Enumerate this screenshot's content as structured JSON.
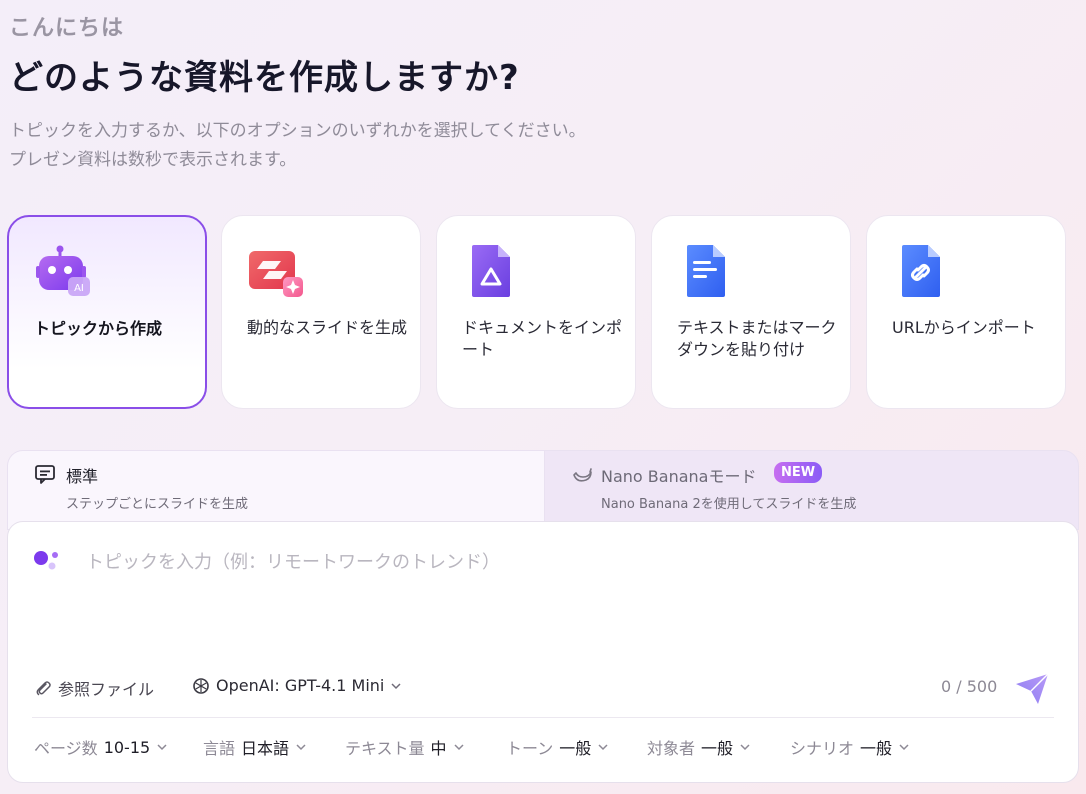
{
  "header": {
    "greeting": "こんにちは",
    "title": "どのような資料を作成しますか?",
    "subtitle_line1": "トピックを入力するか、以下のオプションのいずれかを選択してください。",
    "subtitle_line2": "プレゼン資料は数秒で表示されます。"
  },
  "options": [
    {
      "label": "トピックから作成",
      "icon": "robot-ai-icon",
      "selected": true
    },
    {
      "label": "動的なスライドを生成",
      "icon": "slides-sparkle-icon",
      "selected": false
    },
    {
      "label": "ドキュメントをインポート",
      "icon": "drive-document-icon",
      "selected": false
    },
    {
      "label": "テキストまたはマークダウンを貼り付け",
      "icon": "text-document-icon",
      "selected": false
    },
    {
      "label": "URLからインポート",
      "icon": "link-document-icon",
      "selected": false
    }
  ],
  "modes": {
    "standard": {
      "title": "標準",
      "subtitle": "ステップごとにスライドを生成",
      "icon": "chat-slide-icon"
    },
    "nano": {
      "title": "Nano Bananaモード",
      "subtitle": "Nano Banana 2を使用してスライドを生成",
      "badge": "NEW",
      "icon": "banana-icon"
    }
  },
  "composer": {
    "placeholder": "トピックを入力（例：リモートワークのトレンド）",
    "reference_label": "参照ファイル",
    "model_label": "OpenAI: GPT-4.1 Mini",
    "counter": "0 / 500"
  },
  "settings": [
    {
      "key": "ページ数",
      "value": "10-15"
    },
    {
      "key": "言語",
      "value": "日本語"
    },
    {
      "key": "テキスト量",
      "value": "中"
    },
    {
      "key": "トーン",
      "value": "一般"
    },
    {
      "key": "対象者",
      "value": "一般"
    },
    {
      "key": "シナリオ",
      "value": "一般"
    }
  ],
  "colors": {
    "accent": "#8a4ee8",
    "badge_start": "#c66ef0",
    "badge_end": "#8b5cf6"
  }
}
